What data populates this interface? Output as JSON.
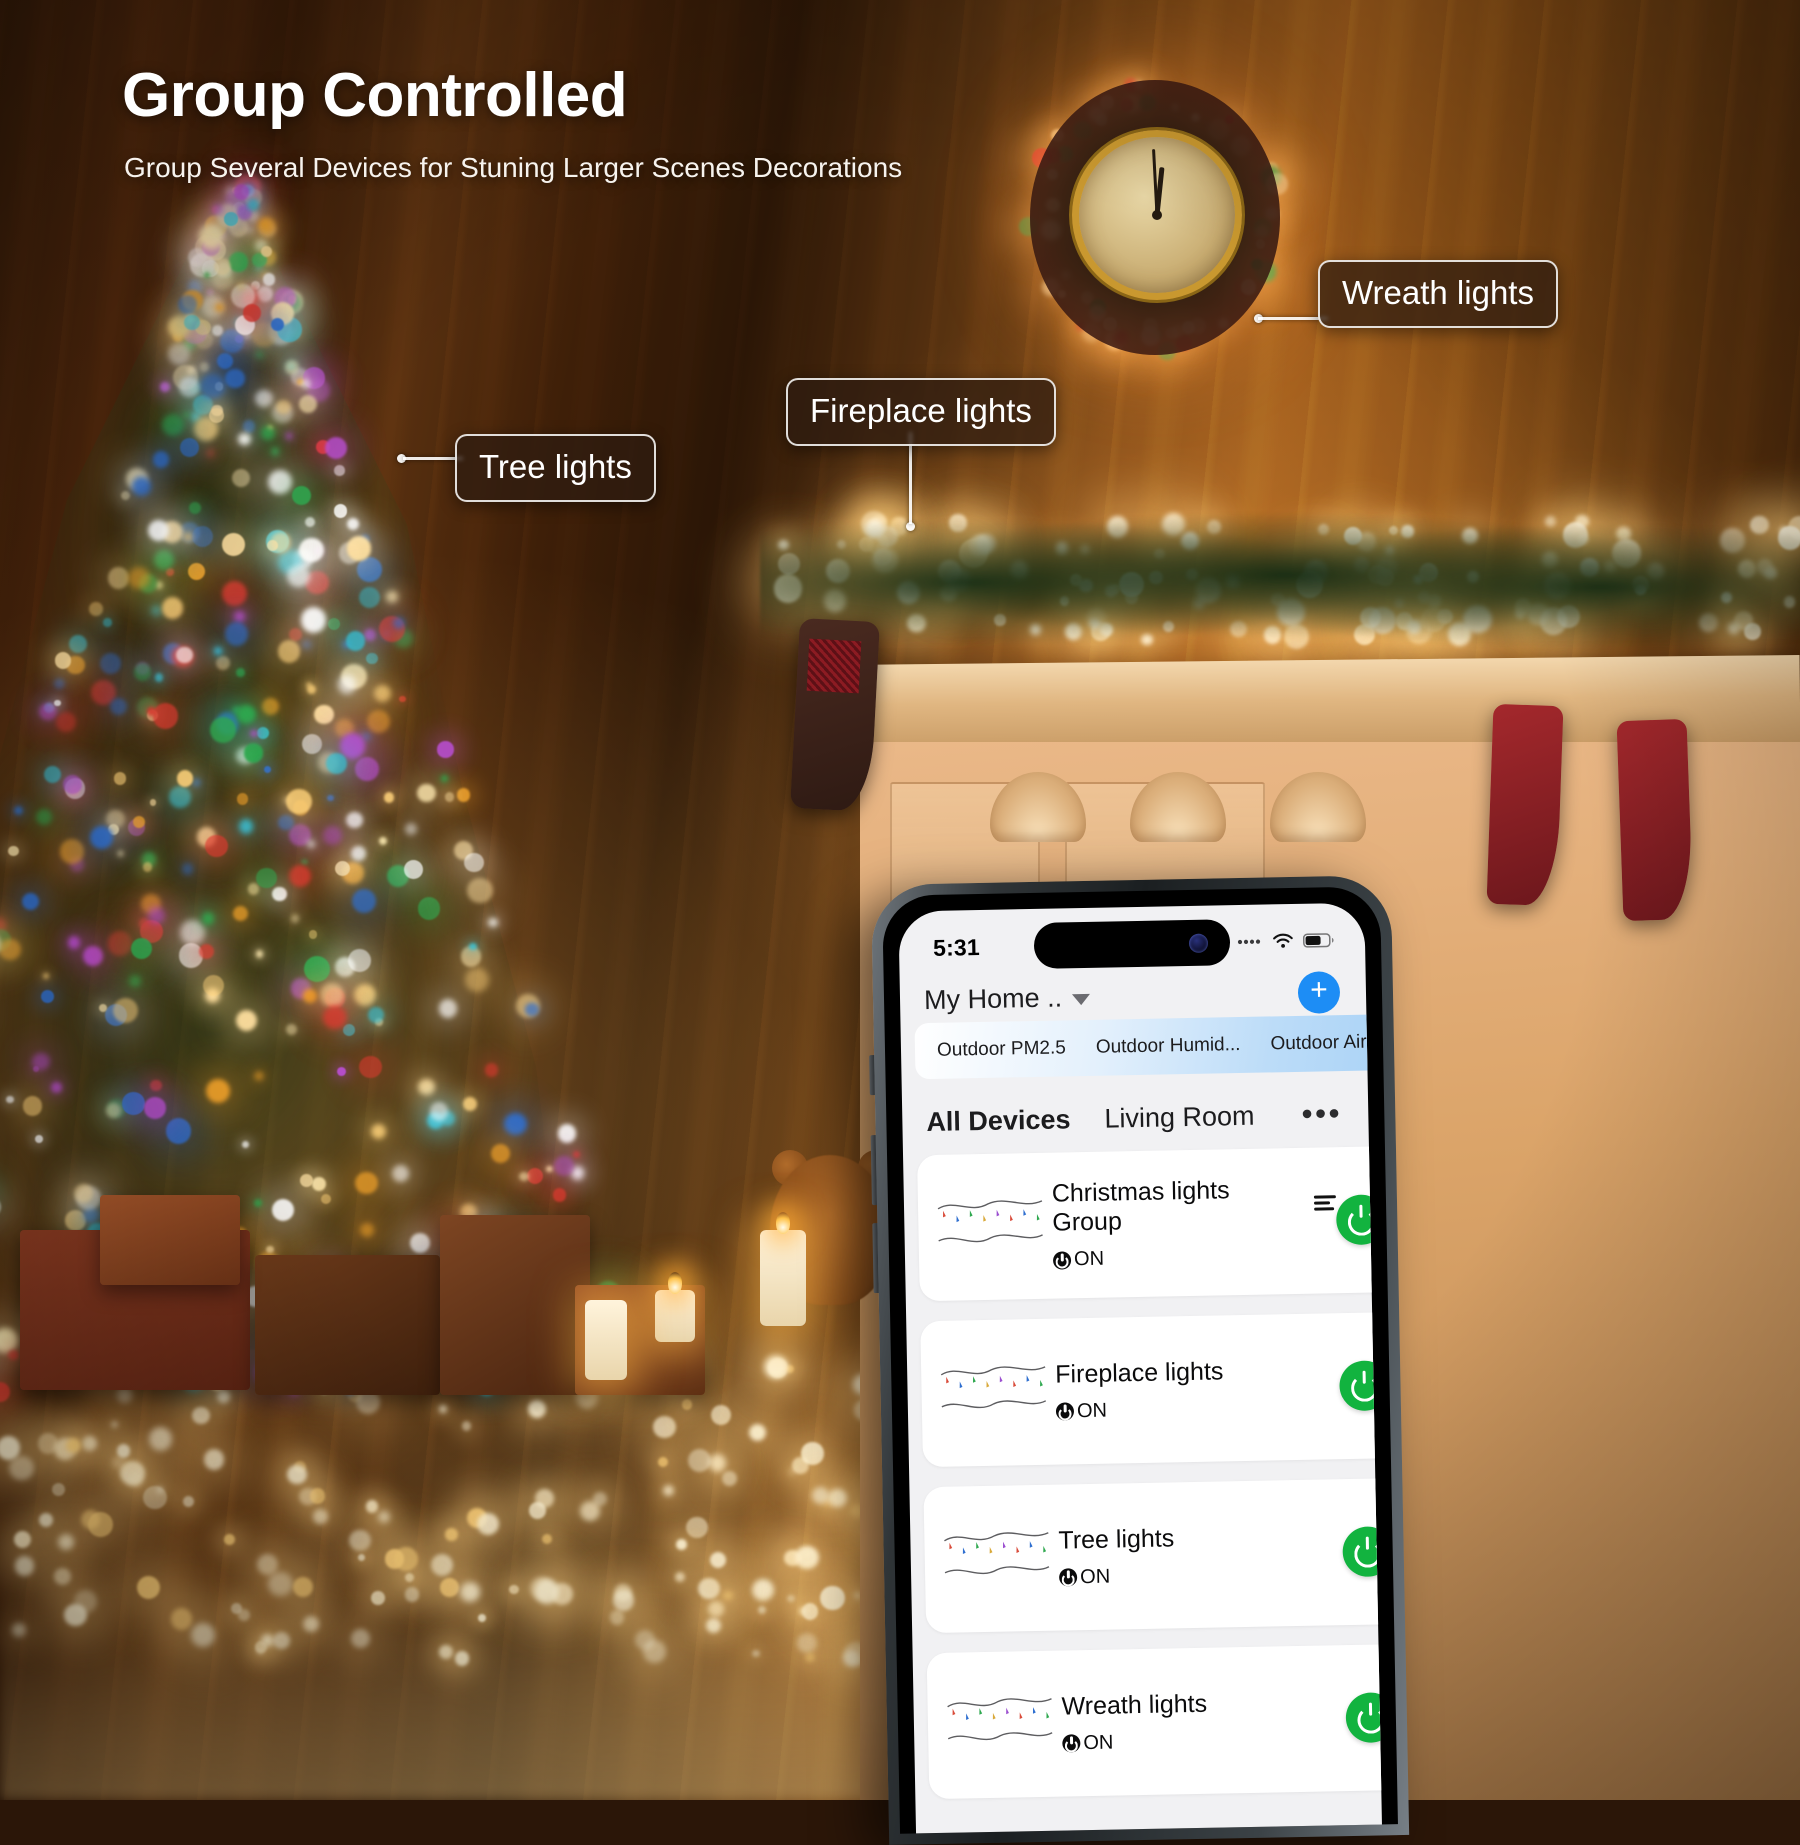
{
  "heading": {
    "title": "Group Controlled",
    "subtitle": "Group Several Devices for Stuning Larger Scenes Decorations"
  },
  "callouts": [
    {
      "label": "Wreath lights"
    },
    {
      "label": "Fireplace lights"
    },
    {
      "label": "Tree lights"
    }
  ],
  "phone": {
    "status_bar": {
      "time": "5:31",
      "signal_icon": "cellular-signal-icon",
      "wifi_icon": "wifi-icon",
      "battery_icon": "battery-icon"
    },
    "app": {
      "home_name": "My Home ..",
      "home_dropdown_icon": "chevron-down-icon",
      "add_label": "+",
      "weather_items": [
        "Outdoor PM2.5",
        "Outdoor Humid...",
        "Outdoor Air Pr..."
      ],
      "tabs": [
        {
          "label": "All Devices",
          "active": true
        },
        {
          "label": "Living Room",
          "active": false
        }
      ],
      "more_label": "•••",
      "devices": [
        {
          "name": "Christmas lights Group",
          "is_group": true,
          "status": "ON",
          "toggle_state": "on",
          "toggle_color": "#12b33f",
          "icon": "string-lights-icon"
        },
        {
          "name": "Fireplace lights",
          "is_group": false,
          "status": "ON",
          "toggle_state": "on",
          "toggle_color": "#12b33f",
          "icon": "string-lights-icon"
        },
        {
          "name": "Tree lights",
          "is_group": false,
          "status": "ON",
          "toggle_state": "on",
          "toggle_color": "#12b33f",
          "icon": "string-lights-icon"
        },
        {
          "name": "Wreath lights",
          "is_group": false,
          "status": "ON",
          "toggle_state": "on",
          "toggle_color": "#12b33f",
          "icon": "string-lights-icon"
        }
      ]
    }
  },
  "colors": {
    "accent_blue": "#1d8df5",
    "toggle_green": "#12b33f",
    "callout_border": "#ffffff",
    "callout_fill": "rgba(46,28,16,0.72)"
  }
}
